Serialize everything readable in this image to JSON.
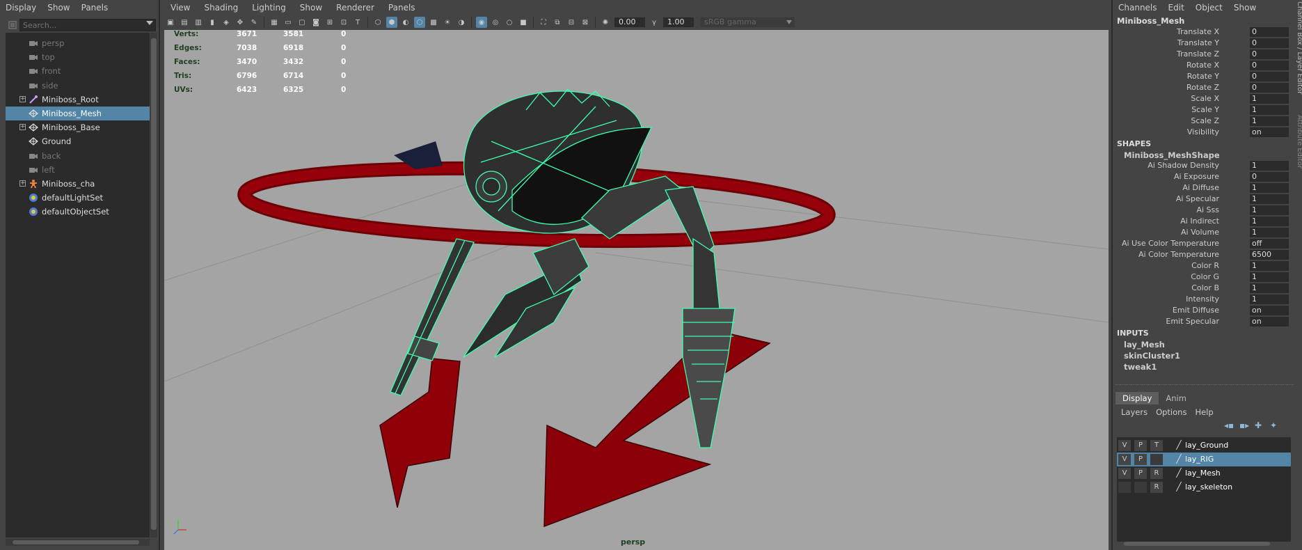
{
  "outliner": {
    "menu": [
      "Display",
      "Show",
      "Panels"
    ],
    "search_placeholder": "Search...",
    "items": [
      {
        "label": "persp",
        "type": "camera",
        "dim": true,
        "expand": false,
        "selected": false
      },
      {
        "label": "top",
        "type": "camera",
        "dim": true,
        "expand": false,
        "selected": false
      },
      {
        "label": "front",
        "type": "camera",
        "dim": true,
        "expand": false,
        "selected": false
      },
      {
        "label": "side",
        "type": "camera",
        "dim": true,
        "expand": false,
        "selected": false
      },
      {
        "label": "Miniboss_Root",
        "type": "joint",
        "dim": false,
        "expand": true,
        "selected": false
      },
      {
        "label": "Miniboss_Mesh",
        "type": "mesh",
        "dim": false,
        "expand": false,
        "selected": true
      },
      {
        "label": "Miniboss_Base",
        "type": "mesh",
        "dim": false,
        "expand": true,
        "selected": false
      },
      {
        "label": "Ground",
        "type": "mesh",
        "dim": false,
        "expand": false,
        "selected": false
      },
      {
        "label": "back",
        "type": "camera",
        "dim": true,
        "expand": false,
        "selected": false
      },
      {
        "label": "left",
        "type": "camera",
        "dim": true,
        "expand": false,
        "selected": false
      },
      {
        "label": "Miniboss_cha",
        "type": "character",
        "dim": false,
        "expand": true,
        "selected": false
      },
      {
        "label": "defaultLightSet",
        "type": "set",
        "dim": false,
        "expand": false,
        "selected": false
      },
      {
        "label": "defaultObjectSet",
        "type": "set",
        "dim": false,
        "expand": false,
        "selected": false
      }
    ]
  },
  "viewport": {
    "menu": [
      "View",
      "Shading",
      "Lighting",
      "Show",
      "Renderer",
      "Panels"
    ],
    "exposure": "0.00",
    "gamma_value": "1.00",
    "color_space": "sRGB gamma",
    "hud": [
      {
        "label": "Verts:",
        "a": "3671",
        "b": "3581",
        "c": "0"
      },
      {
        "label": "Edges:",
        "a": "7038",
        "b": "6918",
        "c": "0"
      },
      {
        "label": "Faces:",
        "a": "3470",
        "b": "3432",
        "c": "0"
      },
      {
        "label": "Tris:",
        "a": "6796",
        "b": "6714",
        "c": "0"
      },
      {
        "label": "UVs:",
        "a": "6423",
        "b": "6325",
        "c": "0"
      }
    ],
    "camera_label": "persp",
    "colors": {
      "background": "#a4a4a4",
      "wire": "#3dffb0",
      "control": "#8b0008"
    }
  },
  "channel_box": {
    "menu": [
      "Channels",
      "Edit",
      "Object",
      "Show"
    ],
    "object_name": "Miniboss_Mesh",
    "transform": [
      {
        "name": "Translate X",
        "value": "0"
      },
      {
        "name": "Translate Y",
        "value": "0"
      },
      {
        "name": "Translate Z",
        "value": "0"
      },
      {
        "name": "Rotate X",
        "value": "0"
      },
      {
        "name": "Rotate Y",
        "value": "0"
      },
      {
        "name": "Rotate Z",
        "value": "0"
      },
      {
        "name": "Scale X",
        "value": "1"
      },
      {
        "name": "Scale Y",
        "value": "1"
      },
      {
        "name": "Scale Z",
        "value": "1"
      },
      {
        "name": "Visibility",
        "value": "on"
      }
    ],
    "shapes_header": "SHAPES",
    "shape_name": "Miniboss_MeshShape",
    "shape_attrs": [
      {
        "name": "Ai Shadow Density",
        "value": "1"
      },
      {
        "name": "Ai Exposure",
        "value": "0"
      },
      {
        "name": "Ai Diffuse",
        "value": "1"
      },
      {
        "name": "Ai Specular",
        "value": "1"
      },
      {
        "name": "Ai Sss",
        "value": "1"
      },
      {
        "name": "Ai Indirect",
        "value": "1"
      },
      {
        "name": "Ai Volume",
        "value": "1"
      },
      {
        "name": "Ai Use Color Temperature",
        "value": "off"
      },
      {
        "name": "Ai Color Temperature",
        "value": "6500"
      },
      {
        "name": "Color R",
        "value": "1"
      },
      {
        "name": "Color G",
        "value": "1"
      },
      {
        "name": "Color B",
        "value": "1"
      },
      {
        "name": "Intensity",
        "value": "1"
      },
      {
        "name": "Emit Diffuse",
        "value": "on"
      },
      {
        "name": "Emit Specular",
        "value": "on"
      }
    ],
    "inputs_header": "INPUTS",
    "inputs": [
      "lay_Mesh",
      "skinCluster1",
      "tweak1"
    ],
    "side_tab_1": "Channel Box / Layer Editor",
    "side_tab_2": "Attribute Editor"
  },
  "layer_editor": {
    "tabs": [
      "Display",
      "Anim"
    ],
    "menu": [
      "Layers",
      "Options",
      "Help"
    ],
    "layers": [
      {
        "v": "V",
        "p": "P",
        "t": "T",
        "name": "lay_Ground",
        "selected": false
      },
      {
        "v": "V",
        "p": "P",
        "t": "",
        "name": "lay_RIG",
        "selected": true
      },
      {
        "v": "V",
        "p": "P",
        "t": "R",
        "name": "lay_Mesh",
        "selected": false
      },
      {
        "v": "",
        "p": "",
        "t": "R",
        "name": "lay_skeleton",
        "selected": false
      }
    ]
  }
}
